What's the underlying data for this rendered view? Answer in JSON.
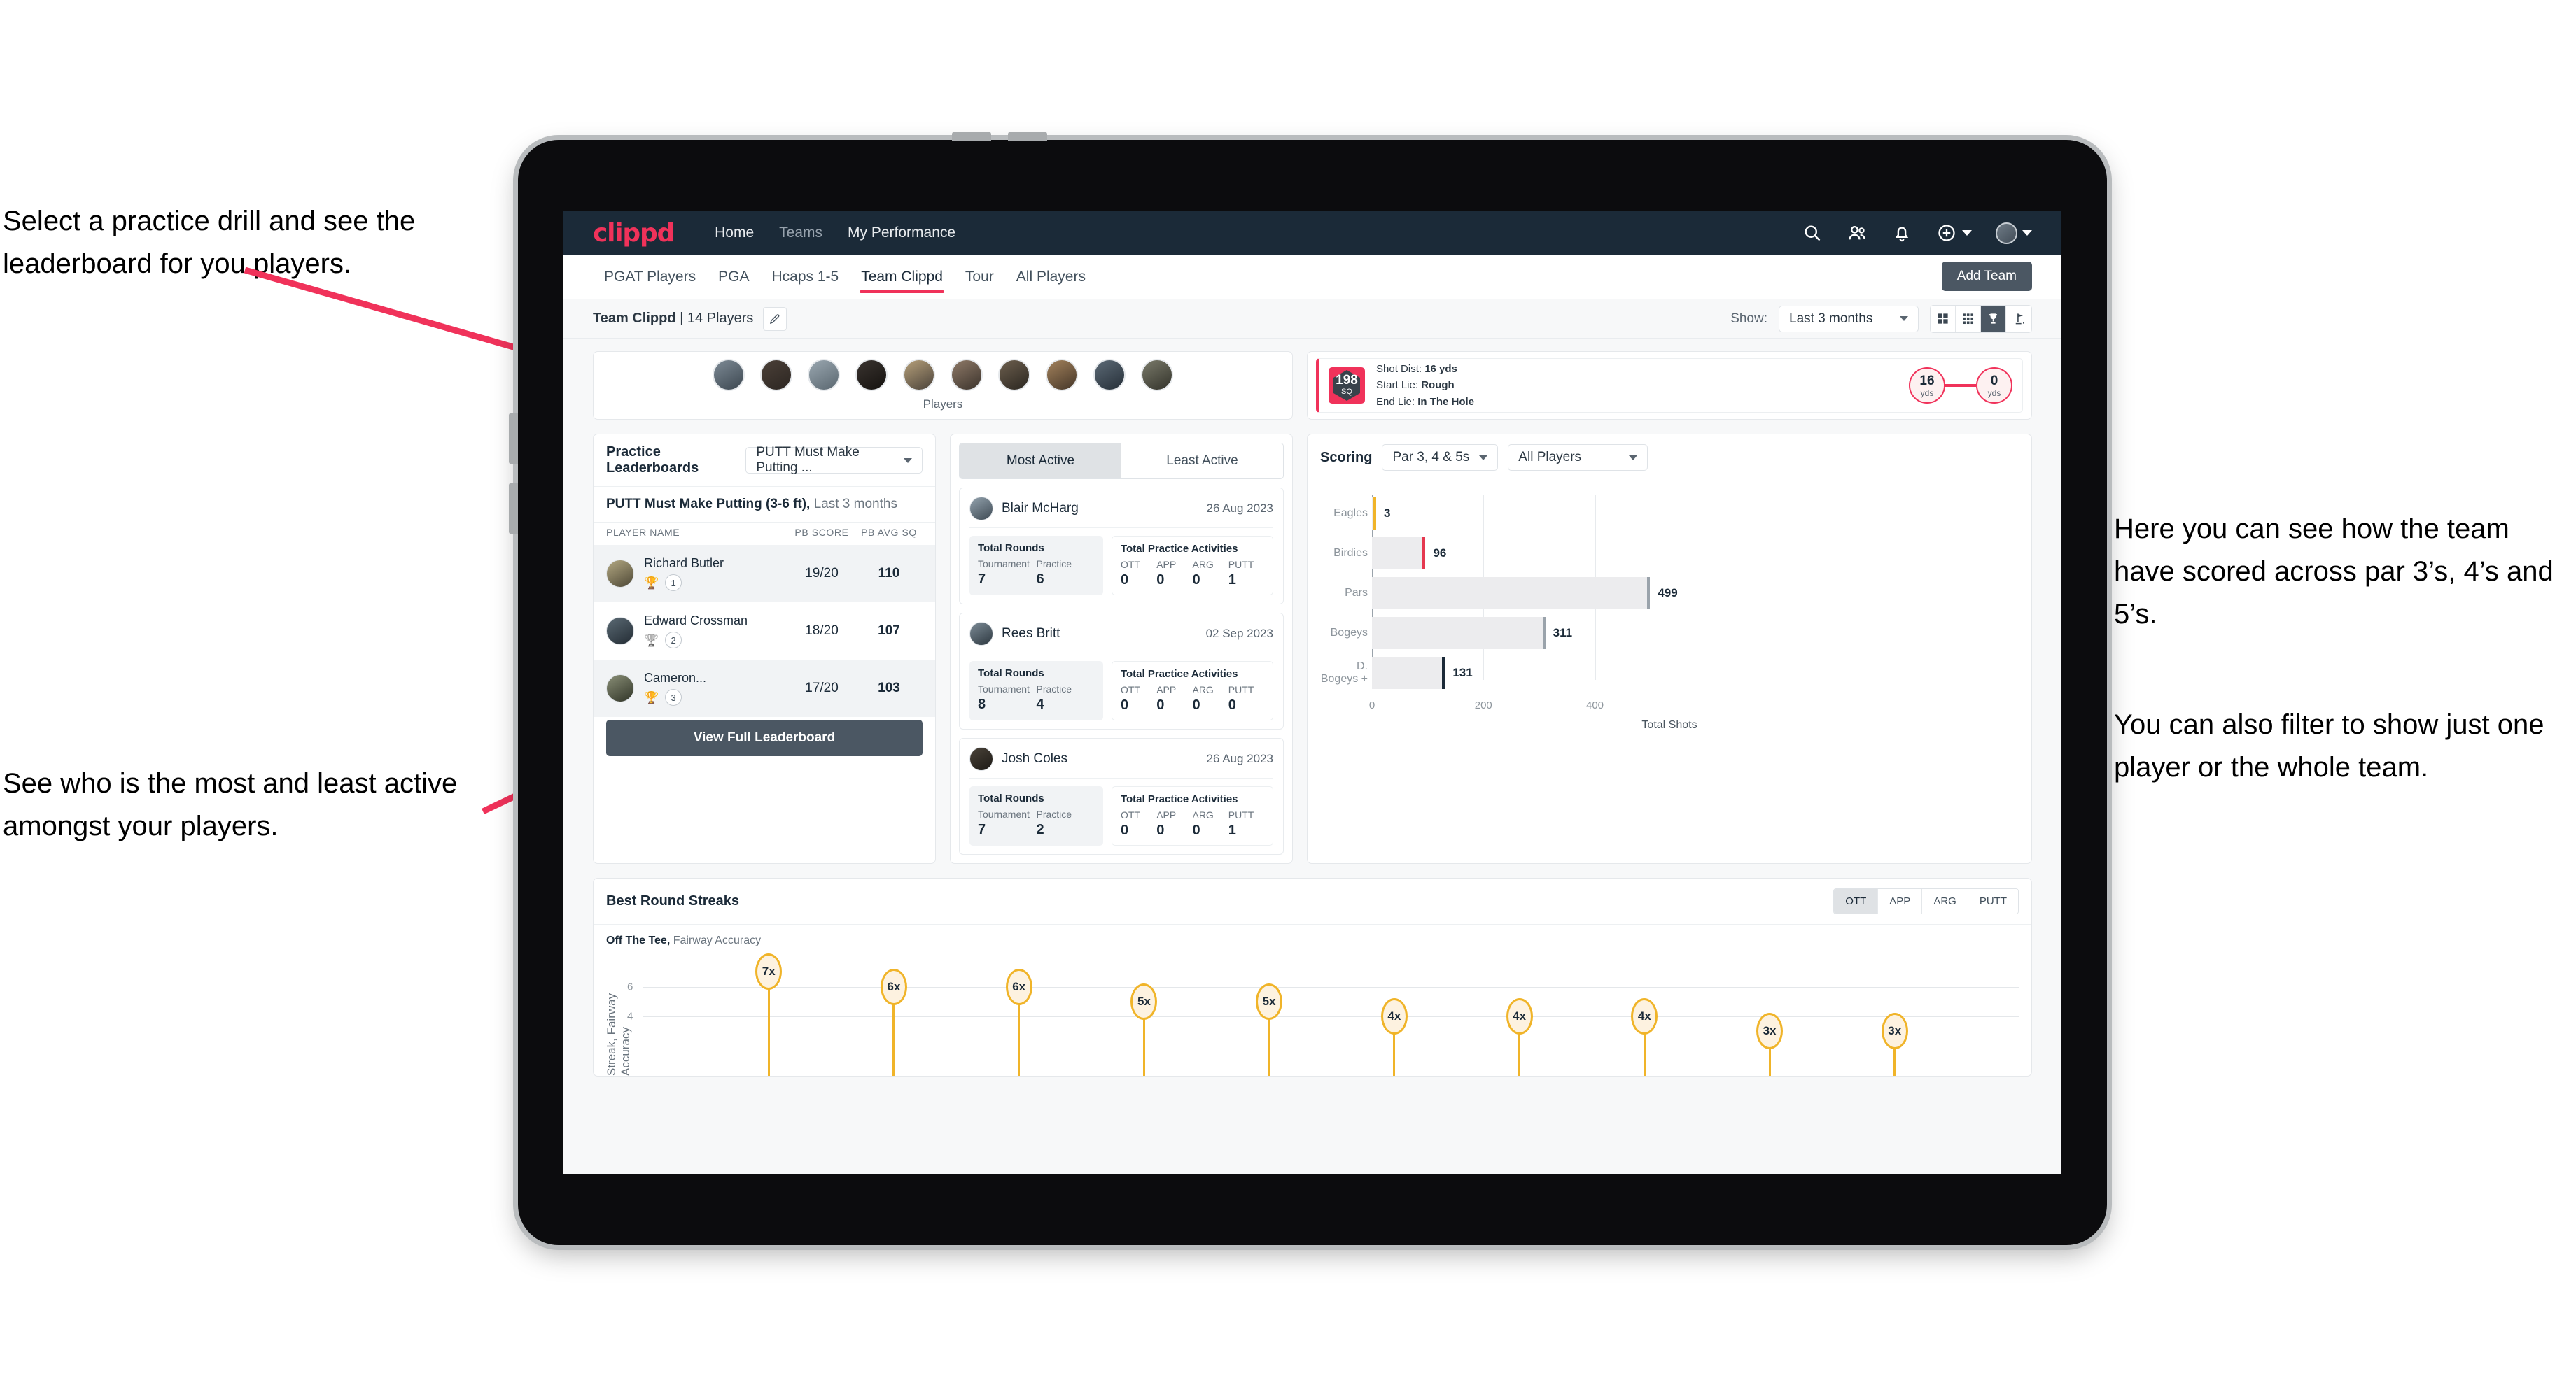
{
  "annotations": {
    "top_left": "Select a practice drill and see the leaderboard for you players.",
    "bottom_left": "See who is the most and least active amongst your players.",
    "right_1": "Here you can see how the team have scored across par 3’s, 4’s and 5’s.",
    "right_2": "You can also filter to show just one player or the whole team."
  },
  "navbar": {
    "logo": "clippd",
    "links": [
      {
        "label": "Home",
        "active": true
      },
      {
        "label": "Teams",
        "active": false
      },
      {
        "label": "My Performance",
        "active": true
      }
    ],
    "icons": [
      "search-icon",
      "people-icon",
      "bell-icon",
      "plus-circle-icon",
      "avatar-icon"
    ]
  },
  "tabs": [
    {
      "label": "PGAT Players",
      "active": false
    },
    {
      "label": "PGA",
      "active": false
    },
    {
      "label": "Hcaps 1-5",
      "active": false
    },
    {
      "label": "Team Clippd",
      "active": true
    },
    {
      "label": "Tour",
      "active": false
    },
    {
      "label": "All Players",
      "active": false
    }
  ],
  "add_team_button": "Add Team",
  "subbar": {
    "team_name": "Team Clippd",
    "team_count": "14 Players",
    "separator": "|",
    "show_label": "Show:",
    "period_value": "Last 3 months",
    "view_toggles": [
      {
        "icon": "grid-4-icon",
        "active": false
      },
      {
        "icon": "grid-9-icon",
        "active": false
      },
      {
        "icon": "trophy-icon",
        "active": true
      },
      {
        "icon": "golf-flag-icon",
        "active": false
      }
    ]
  },
  "players_strip": {
    "label": "Players",
    "count": 10
  },
  "shot_card": {
    "badge_value": "198",
    "badge_unit": "SQ",
    "lines": [
      {
        "label": "Shot Dist:",
        "value": "16 yds"
      },
      {
        "label": "Start Lie:",
        "value": "Rough"
      },
      {
        "label": "End Lie:",
        "value": "In The Hole"
      }
    ],
    "start_dist": "16",
    "start_unit": "yds",
    "end_dist": "0",
    "end_unit": "yds"
  },
  "leaderboard": {
    "title": "Practice Leaderboards",
    "drill_select": "PUTT Must Make Putting ...",
    "subtitle_drill": "PUTT Must Make Putting (3-6 ft),",
    "subtitle_period": "Last 3 months",
    "columns": [
      "PLAYER NAME",
      "PB SCORE",
      "PB AVG SQ"
    ],
    "rows": [
      {
        "name": "Richard Butler",
        "rank": "1",
        "trophy": "gold",
        "pb_score": "19/20",
        "pb_avg_sq": "110"
      },
      {
        "name": "Edward Crossman",
        "rank": "2",
        "trophy": "silver",
        "pb_score": "18/20",
        "pb_avg_sq": "107"
      },
      {
        "name": "Cameron...",
        "rank": "3",
        "trophy": "bronze",
        "pb_score": "17/20",
        "pb_avg_sq": "103"
      }
    ],
    "view_full_button": "View Full Leaderboard"
  },
  "activity": {
    "tabs": [
      {
        "label": "Most Active",
        "active": true
      },
      {
        "label": "Least Active",
        "active": false
      }
    ],
    "rounds_title": "Total Rounds",
    "practice_title": "Total Practice Activities",
    "rounds_labels": [
      "Tournament",
      "Practice"
    ],
    "practice_labels": [
      "OTT",
      "APP",
      "ARG",
      "PUTT"
    ],
    "items": [
      {
        "name": "Blair McHarg",
        "date": "26 Aug 2023",
        "tournament": "7",
        "practice": "6",
        "ott": "0",
        "app": "0",
        "arg": "0",
        "putt": "1"
      },
      {
        "name": "Rees Britt",
        "date": "02 Sep 2023",
        "tournament": "8",
        "practice": "4",
        "ott": "0",
        "app": "0",
        "arg": "0",
        "putt": "0"
      },
      {
        "name": "Josh Coles",
        "date": "26 Aug 2023",
        "tournament": "7",
        "practice": "2",
        "ott": "0",
        "app": "0",
        "arg": "0",
        "putt": "1"
      }
    ]
  },
  "scoring": {
    "title": "Scoring",
    "par_select": "Par 3, 4 & 5s",
    "player_select": "All Players"
  },
  "streaks": {
    "title": "Best Round Streaks",
    "toggles": [
      {
        "label": "OTT",
        "active": true
      },
      {
        "label": "APP",
        "active": false
      },
      {
        "label": "ARG",
        "active": false
      },
      {
        "label": "PUTT",
        "active": false
      }
    ],
    "subtitle_bold": "Off The Tee,",
    "subtitle_rest": "Fairway Accuracy"
  },
  "colors": {
    "brand_pink": "#f0325a",
    "navy": "#1b2a38",
    "slate": "#4b5763",
    "amber": "#f0b429",
    "annotation_arrow": "#f0325a"
  },
  "chart_data": [
    {
      "type": "bar",
      "orientation": "horizontal",
      "title": "Scoring",
      "categories": [
        "Eagles",
        "Birdies",
        "Pars",
        "Bogeys",
        "D. Bogeys +"
      ],
      "values": [
        3,
        96,
        499,
        311,
        131
      ],
      "cap_colors": [
        "#f0b429",
        "#e5384f",
        "#9aa3ab",
        "#9aa3ab",
        "#1b2a38"
      ],
      "xlabel": "Total Shots",
      "ylabel": "",
      "xticks": [
        0,
        200,
        400
      ],
      "xlim": [
        0,
        540
      ],
      "grid": true,
      "legend": false
    },
    {
      "type": "scatter",
      "subtype": "lollipop",
      "title": "Best Round Streaks",
      "series_name": "Off The Tee, Fairway Accuracy",
      "values": [
        7,
        6,
        6,
        5,
        5,
        4,
        4,
        4,
        3,
        3
      ],
      "labels": [
        "7x",
        "6x",
        "6x",
        "5x",
        "5x",
        "4x",
        "4x",
        "4x",
        "3x",
        "3x"
      ],
      "ylabel": "Streak, Fairway Accuracy",
      "yticks": [
        4,
        6
      ],
      "ylim": [
        0,
        8
      ],
      "grid": true,
      "legend": false
    }
  ]
}
